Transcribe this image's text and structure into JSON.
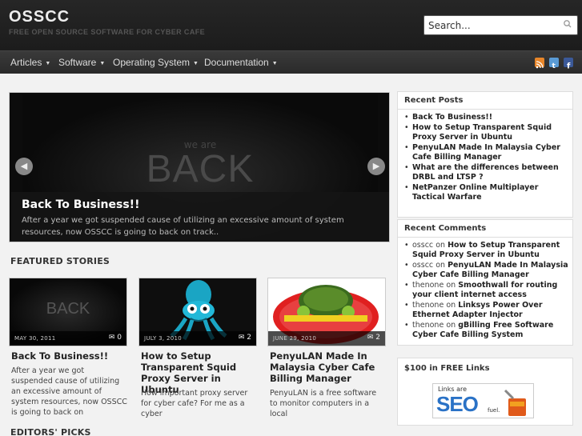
{
  "header": {
    "title": "OSSCC",
    "tagline": "FREE OPEN SOURCE SOFTWARE FOR CYBER CAFE",
    "search_placeholder": "Search..."
  },
  "nav": {
    "items": [
      {
        "label": "Articles"
      },
      {
        "label": "Software"
      },
      {
        "label": "Operating System"
      },
      {
        "label": "Documentation"
      }
    ],
    "social_icons": [
      "rss-icon",
      "twitter-icon",
      "facebook-icon"
    ]
  },
  "slider": {
    "image_text_small": "we are",
    "image_text_big": "BACK",
    "title": "Back To Business!!",
    "excerpt": "After a year we got suspended cause of utilizing an excessive amount of system resources, now OSSCC is going to back on track.."
  },
  "featured": {
    "heading": "FEATURED STORIES",
    "stories": [
      {
        "date": "MAY 30, 2011",
        "comments": "0",
        "title": "Back To Business!!",
        "excerpt": "After a year we got suspended cause of utilizing an excessive amount of system resources, now OSSCC is going to back on",
        "image_text": "BACK"
      },
      {
        "date": "JULY 3, 2010",
        "comments": "2",
        "title": "How to Setup Transparent Squid Proxy Server in Ubuntu",
        "excerpt": "How important proxy server for cyber cafe? For me as a cyber"
      },
      {
        "date": "JUNE 29, 2010",
        "comments": "2",
        "title": "PenyuLAN Made In Malaysia Cyber Cafe Billing Manager",
        "excerpt": "PenyuLAN is a free software to monitor computers in a local"
      }
    ]
  },
  "editors_picks": {
    "heading": "EDITORS' PICKS"
  },
  "sidebar": {
    "recent_posts": {
      "title": "Recent Posts",
      "items": [
        "Back To Business!!",
        "How to Setup Transparent Squid Proxy Server in Ubuntu",
        "PenyuLAN Made In Malaysia Cyber Cafe Billing Manager",
        "What are the differences between DRBL and LTSP ?",
        "NetPanzer Online Multiplayer Tactical Warfare"
      ]
    },
    "recent_comments": {
      "title": "Recent Comments",
      "items": [
        {
          "author": "osscc",
          "on": "on",
          "post": "How to Setup Transparent Squid Proxy Server in Ubuntu"
        },
        {
          "author": "osscc",
          "on": "on",
          "post": "PenyuLAN Made In Malaysia Cyber Cafe Billing Manager"
        },
        {
          "author": "thenone",
          "on": "on",
          "post": "Smoothwall for routing your client internet access"
        },
        {
          "author": "thenone",
          "on": "on",
          "post": "Linksys Power Over Ethernet Adapter Injector"
        },
        {
          "author": "thenone",
          "on": "on",
          "post": "gBilling Free Software Cyber Cafe Billing System"
        }
      ]
    },
    "links": {
      "title": "$100 in FREE Links",
      "banner_top": "Links are",
      "banner_main": "SEO",
      "banner_suffix": "fuel."
    }
  },
  "colors": {
    "header_bg": "#222222",
    "nav_bg": "#333333",
    "page_bg": "#f2f2f2",
    "rss": "#e8862a",
    "twitter": "#5a9bd5",
    "facebook": "#3b5998"
  }
}
